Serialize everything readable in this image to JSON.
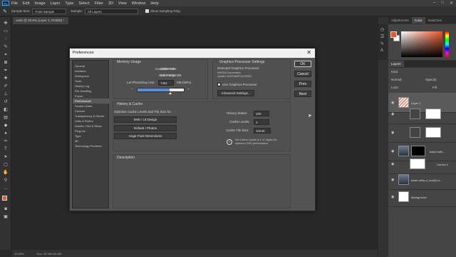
{
  "menu": [
    "File",
    "Edit",
    "Image",
    "Layer",
    "Type",
    "Select",
    "Filter",
    "3D",
    "View",
    "Window",
    "Help"
  ],
  "app_logo": "Ps",
  "window_controls": [
    "–",
    "□",
    "✕"
  ],
  "options_bar": {
    "sample_size_label": "Sample Size:",
    "sample_size_value": "Point Sample",
    "sample_label": "Sample:",
    "sample_value": "All Layers",
    "sampling_ring_label": "Show Sampling Ring"
  },
  "doc_tab": "undo @ 20.8% (Layer 1, RGB/8) *",
  "status": {
    "zoom": "20.83%",
    "doc": "Doc: 26.9M/116.6M"
  },
  "panels": {
    "color_tabs": [
      "Adjustments",
      "Color",
      "Swatches"
    ],
    "layers_tabs": [
      "Layers"
    ],
    "layers_search": "Kind",
    "blend_mode": "Normal",
    "opacity_label": "Opacity:",
    "lock_label": "Lock:",
    "fill_label": "Fill:",
    "layers": [
      "Layer 1",
      "",
      "",
      "basin-halli...",
      "Curves 1",
      "basin-nelly-a_root(3)-k...",
      "Background"
    ]
  },
  "colors": {
    "foreground": "#e8562a",
    "background": "#ffffff",
    "accent_bar": "#5b8fd8"
  },
  "dialog": {
    "title": "Preferences",
    "close": "✕",
    "nav": [
      "General",
      "Interface",
      "Workspace",
      "Tools",
      "History Log",
      "File Handling",
      "Export",
      "Performance",
      "Scratch Disks",
      "Cursors",
      "Transparency & Gamut",
      "Units & Rulers",
      "Guides, Grid & Slices",
      "Plug-Ins",
      "Type",
      "3D",
      "Technology Previews"
    ],
    "nav_active_index": 7,
    "memory": {
      "title": "Memory Usage",
      "available_label": "Available RAM:",
      "available_value": "10658 MB",
      "ideal_label": "Ideal Range:",
      "ideal_value": "5862-7674 MB",
      "let_label": "Let Photoshop Use:",
      "let_value": "7461",
      "let_unit": "MB (69%)",
      "minus": "–",
      "plus": "+",
      "usage_percent": 69
    },
    "gpu": {
      "title": "Graphics Processor Settings",
      "detected_label": "Detected Graphics Processor:",
      "vendor": "NVIDIA Corporation",
      "model": "Quadro K2000M/PCIe/SSE2",
      "use_gpu_label": "Use Graphics Processor",
      "advanced_button": "Advanced Settings..."
    },
    "history": {
      "title": "History & Cache",
      "optimize_label": "Optimize Cache Levels and Tile Size for:",
      "btn_web": "Web / UI Design",
      "btn_default": "Default / Photos",
      "btn_huge": "Huge Pixel Dimensions",
      "states_label": "History States:",
      "states_value": "200",
      "levels_label": "Cache Levels:",
      "levels_value": "4",
      "tile_label": "Cache Tile Size:",
      "tile_value": "1024K",
      "info_line1": "Set Cache Levels to 2 or higher for",
      "info_line2": "optimum GPU performance."
    },
    "description": {
      "title": "Description"
    },
    "buttons": {
      "ok": "OK",
      "cancel": "Cancel",
      "prev": "Prev",
      "next": "Next"
    }
  }
}
